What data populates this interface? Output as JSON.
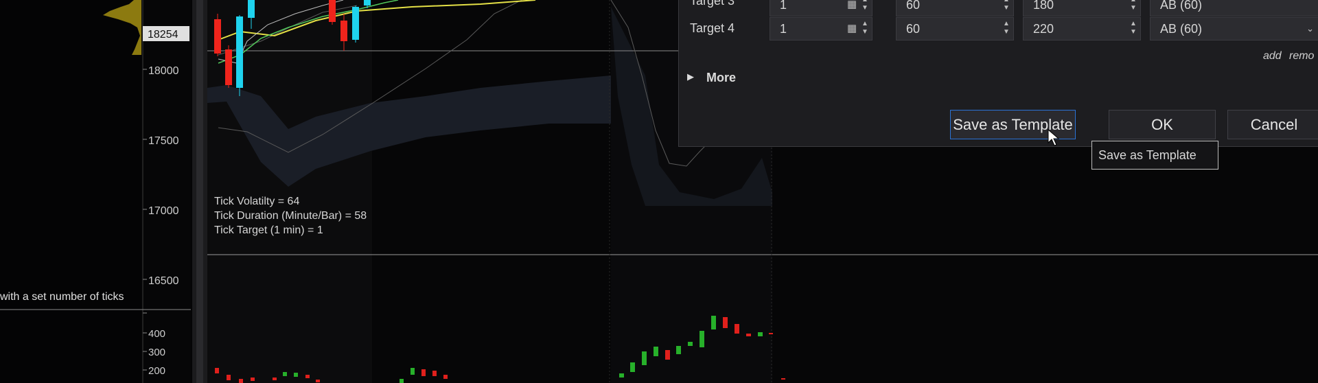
{
  "chart": {
    "price_ticks": [
      "18000",
      "17500",
      "17000",
      "16500"
    ],
    "last_price": "18254",
    "volume_ticks": [
      "400",
      "300",
      "200"
    ],
    "info_lines": [
      "Tick Volatilty = 64",
      "Tick Duration (Minute/Bar) = 58",
      "Tick Target (1 min) = 1"
    ],
    "left_text": "with a set number of ticks",
    "colors": {
      "up": "#1fd3ee",
      "down": "#f0241c",
      "vol_up": "#27b02a",
      "vol_down": "#e0201c",
      "ma_yellow": "#e4e046",
      "ma_green": "#52c75a",
      "volume_profile": "#8c7a10"
    }
  },
  "dialog": {
    "target3": {
      "label": "Target 3",
      "qty": "1",
      "a": "60",
      "b": "180",
      "select": "AB (60)"
    },
    "target4": {
      "label": "Target 4",
      "qty": "1",
      "a": "60",
      "b": "220",
      "select": "AB (60)"
    },
    "add_link": "add",
    "remove_link": "remo",
    "more_label": "More",
    "buttons": {
      "save_template": "Save as Template",
      "ok": "OK",
      "cancel": "Cancel"
    },
    "tooltip": "Save as Template"
  }
}
